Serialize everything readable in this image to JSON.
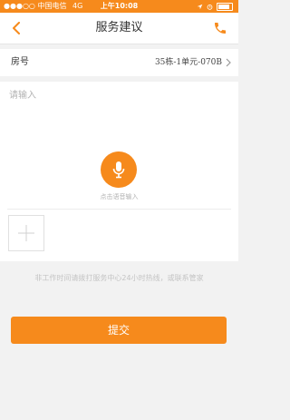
{
  "status_bar": {
    "carrier": "●●●○○ 中国电信",
    "network": "4G",
    "time": "上午10:08"
  },
  "nav": {
    "title": "服务建议"
  },
  "room": {
    "label": "房号",
    "value": "35栋-1单元-070B"
  },
  "input": {
    "placeholder": "请输入",
    "voice_label": "点击语音输入"
  },
  "hint": "非工作时间请拨打服务中心24小时热线，或联系管家",
  "submit_label": "提交",
  "colors": {
    "accent": "#f68a1c",
    "background": "#f2f2f2"
  },
  "icons": [
    "back-arrow-icon",
    "phone-icon",
    "chevron-right-icon",
    "microphone-icon",
    "plus-icon",
    "battery-icon",
    "location-icon",
    "alarm-icon"
  ]
}
